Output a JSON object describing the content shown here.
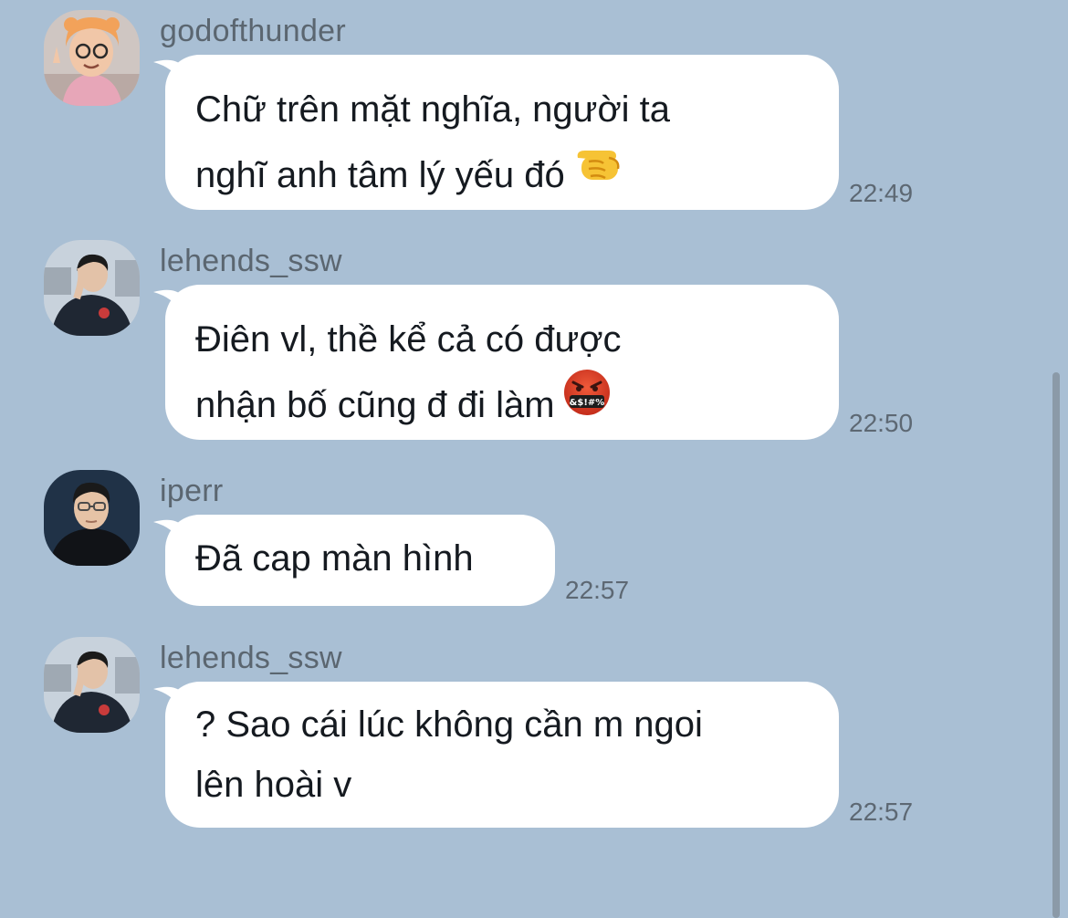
{
  "chat": {
    "messages": [
      {
        "sender": "godofthunder",
        "lines": [
          "Chữ trên mặt nghĩa, người ta",
          "nghĩ anh tâm lý yếu đó"
        ],
        "emoji": "pointing-fist-emoji",
        "time": "22:49"
      },
      {
        "sender": "lehends_ssw",
        "lines": [
          "Điên vl, thề kể cả có được",
          "nhận bố cũng đ đi làm"
        ],
        "emoji": "cursing-face-emoji",
        "time": "22:50"
      },
      {
        "sender": "iperr",
        "lines": [
          "Đã cap màn hình"
        ],
        "time": "22:57"
      },
      {
        "sender": "lehends_ssw",
        "lines": [
          "? Sao cái lúc không cần m ngoi",
          "lên hoài v"
        ],
        "time": "22:57"
      }
    ],
    "cursing_symbols": "&$!#%"
  },
  "colors": {
    "background": "#a9bfd4",
    "bubble": "#ffffff",
    "text": "#151a20",
    "meta_text": "#5d6873"
  }
}
